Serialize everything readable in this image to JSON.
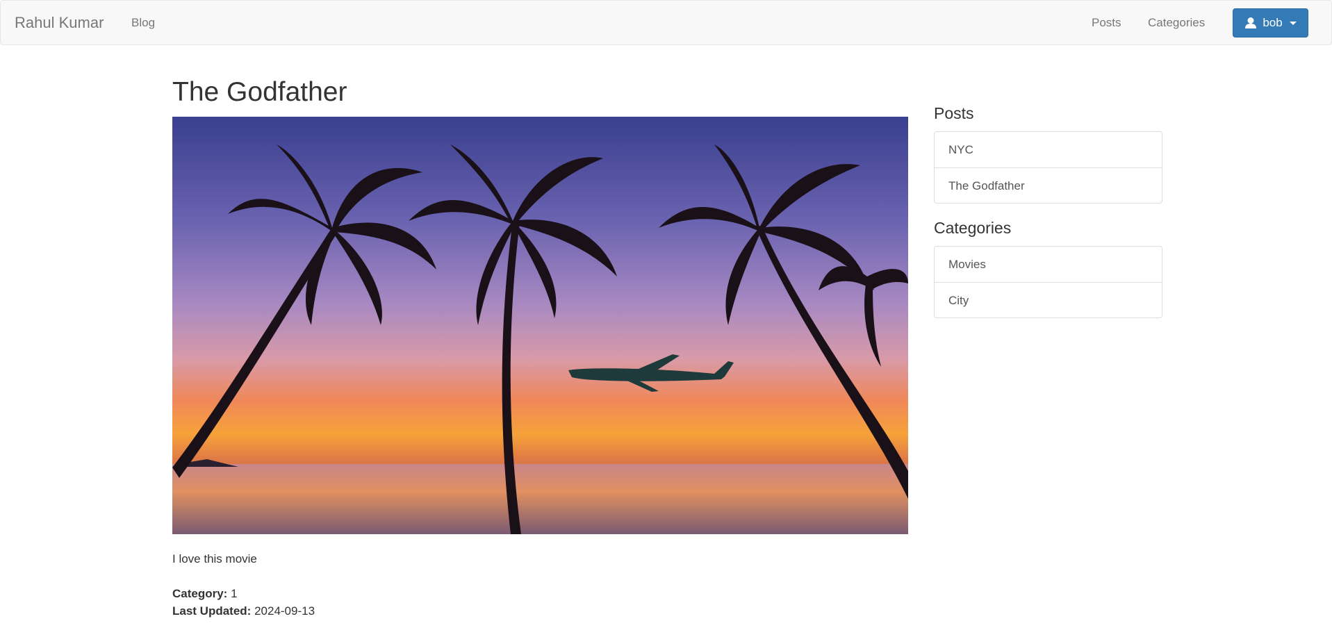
{
  "navbar": {
    "brand": "Rahul Kumar",
    "blog_link": "Blog",
    "posts_link": "Posts",
    "categories_link": "Categories",
    "user_menu": {
      "label": "bob",
      "icon": "user-icon"
    },
    "colors": {
      "background": "#f8f8f8",
      "user_button": "#337ab7"
    }
  },
  "post": {
    "title": "The Godfather",
    "image": {
      "description": "palm trees sunset with airplane"
    },
    "body": "I love this movie",
    "category_label": "Category:",
    "category_value": "1",
    "updated_label": "Last Updated:",
    "updated_value": "2024-09-13"
  },
  "sidebar": {
    "posts_heading": "Posts",
    "posts": [
      {
        "label": "NYC"
      },
      {
        "label": "The Godfather"
      }
    ],
    "categories_heading": "Categories",
    "categories": [
      {
        "label": "Movies"
      },
      {
        "label": "City"
      }
    ]
  }
}
